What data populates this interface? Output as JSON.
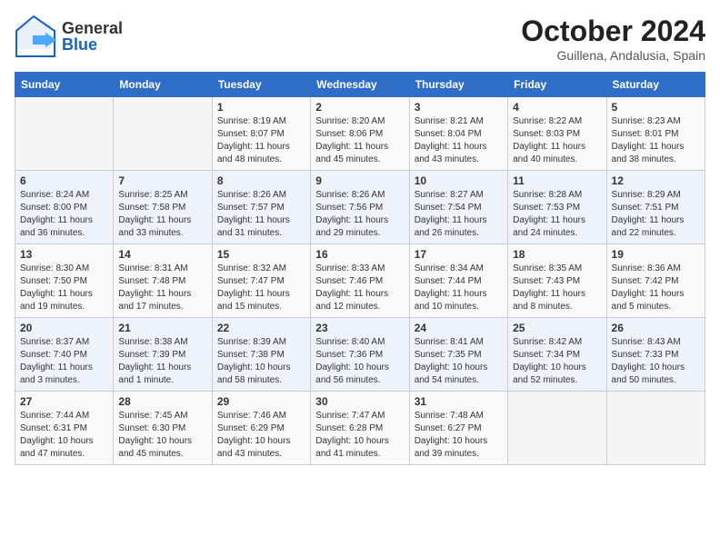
{
  "header": {
    "logo_general": "General",
    "logo_blue": "Blue",
    "month_title": "October 2024",
    "location": "Guillena, Andalusia, Spain"
  },
  "days_of_week": [
    "Sunday",
    "Monday",
    "Tuesday",
    "Wednesday",
    "Thursday",
    "Friday",
    "Saturday"
  ],
  "weeks": [
    [
      {
        "day": "",
        "sunrise": "",
        "sunset": "",
        "daylight": ""
      },
      {
        "day": "",
        "sunrise": "",
        "sunset": "",
        "daylight": ""
      },
      {
        "day": "1",
        "sunrise": "Sunrise: 8:19 AM",
        "sunset": "Sunset: 8:07 PM",
        "daylight": "Daylight: 11 hours and 48 minutes."
      },
      {
        "day": "2",
        "sunrise": "Sunrise: 8:20 AM",
        "sunset": "Sunset: 8:06 PM",
        "daylight": "Daylight: 11 hours and 45 minutes."
      },
      {
        "day": "3",
        "sunrise": "Sunrise: 8:21 AM",
        "sunset": "Sunset: 8:04 PM",
        "daylight": "Daylight: 11 hours and 43 minutes."
      },
      {
        "day": "4",
        "sunrise": "Sunrise: 8:22 AM",
        "sunset": "Sunset: 8:03 PM",
        "daylight": "Daylight: 11 hours and 40 minutes."
      },
      {
        "day": "5",
        "sunrise": "Sunrise: 8:23 AM",
        "sunset": "Sunset: 8:01 PM",
        "daylight": "Daylight: 11 hours and 38 minutes."
      }
    ],
    [
      {
        "day": "6",
        "sunrise": "Sunrise: 8:24 AM",
        "sunset": "Sunset: 8:00 PM",
        "daylight": "Daylight: 11 hours and 36 minutes."
      },
      {
        "day": "7",
        "sunrise": "Sunrise: 8:25 AM",
        "sunset": "Sunset: 7:58 PM",
        "daylight": "Daylight: 11 hours and 33 minutes."
      },
      {
        "day": "8",
        "sunrise": "Sunrise: 8:26 AM",
        "sunset": "Sunset: 7:57 PM",
        "daylight": "Daylight: 11 hours and 31 minutes."
      },
      {
        "day": "9",
        "sunrise": "Sunrise: 8:26 AM",
        "sunset": "Sunset: 7:56 PM",
        "daylight": "Daylight: 11 hours and 29 minutes."
      },
      {
        "day": "10",
        "sunrise": "Sunrise: 8:27 AM",
        "sunset": "Sunset: 7:54 PM",
        "daylight": "Daylight: 11 hours and 26 minutes."
      },
      {
        "day": "11",
        "sunrise": "Sunrise: 8:28 AM",
        "sunset": "Sunset: 7:53 PM",
        "daylight": "Daylight: 11 hours and 24 minutes."
      },
      {
        "day": "12",
        "sunrise": "Sunrise: 8:29 AM",
        "sunset": "Sunset: 7:51 PM",
        "daylight": "Daylight: 11 hours and 22 minutes."
      }
    ],
    [
      {
        "day": "13",
        "sunrise": "Sunrise: 8:30 AM",
        "sunset": "Sunset: 7:50 PM",
        "daylight": "Daylight: 11 hours and 19 minutes."
      },
      {
        "day": "14",
        "sunrise": "Sunrise: 8:31 AM",
        "sunset": "Sunset: 7:48 PM",
        "daylight": "Daylight: 11 hours and 17 minutes."
      },
      {
        "day": "15",
        "sunrise": "Sunrise: 8:32 AM",
        "sunset": "Sunset: 7:47 PM",
        "daylight": "Daylight: 11 hours and 15 minutes."
      },
      {
        "day": "16",
        "sunrise": "Sunrise: 8:33 AM",
        "sunset": "Sunset: 7:46 PM",
        "daylight": "Daylight: 11 hours and 12 minutes."
      },
      {
        "day": "17",
        "sunrise": "Sunrise: 8:34 AM",
        "sunset": "Sunset: 7:44 PM",
        "daylight": "Daylight: 11 hours and 10 minutes."
      },
      {
        "day": "18",
        "sunrise": "Sunrise: 8:35 AM",
        "sunset": "Sunset: 7:43 PM",
        "daylight": "Daylight: 11 hours and 8 minutes."
      },
      {
        "day": "19",
        "sunrise": "Sunrise: 8:36 AM",
        "sunset": "Sunset: 7:42 PM",
        "daylight": "Daylight: 11 hours and 5 minutes."
      }
    ],
    [
      {
        "day": "20",
        "sunrise": "Sunrise: 8:37 AM",
        "sunset": "Sunset: 7:40 PM",
        "daylight": "Daylight: 11 hours and 3 minutes."
      },
      {
        "day": "21",
        "sunrise": "Sunrise: 8:38 AM",
        "sunset": "Sunset: 7:39 PM",
        "daylight": "Daylight: 11 hours and 1 minute."
      },
      {
        "day": "22",
        "sunrise": "Sunrise: 8:39 AM",
        "sunset": "Sunset: 7:38 PM",
        "daylight": "Daylight: 10 hours and 58 minutes."
      },
      {
        "day": "23",
        "sunrise": "Sunrise: 8:40 AM",
        "sunset": "Sunset: 7:36 PM",
        "daylight": "Daylight: 10 hours and 56 minutes."
      },
      {
        "day": "24",
        "sunrise": "Sunrise: 8:41 AM",
        "sunset": "Sunset: 7:35 PM",
        "daylight": "Daylight: 10 hours and 54 minutes."
      },
      {
        "day": "25",
        "sunrise": "Sunrise: 8:42 AM",
        "sunset": "Sunset: 7:34 PM",
        "daylight": "Daylight: 10 hours and 52 minutes."
      },
      {
        "day": "26",
        "sunrise": "Sunrise: 8:43 AM",
        "sunset": "Sunset: 7:33 PM",
        "daylight": "Daylight: 10 hours and 50 minutes."
      }
    ],
    [
      {
        "day": "27",
        "sunrise": "Sunrise: 7:44 AM",
        "sunset": "Sunset: 6:31 PM",
        "daylight": "Daylight: 10 hours and 47 minutes."
      },
      {
        "day": "28",
        "sunrise": "Sunrise: 7:45 AM",
        "sunset": "Sunset: 6:30 PM",
        "daylight": "Daylight: 10 hours and 45 minutes."
      },
      {
        "day": "29",
        "sunrise": "Sunrise: 7:46 AM",
        "sunset": "Sunset: 6:29 PM",
        "daylight": "Daylight: 10 hours and 43 minutes."
      },
      {
        "day": "30",
        "sunrise": "Sunrise: 7:47 AM",
        "sunset": "Sunset: 6:28 PM",
        "daylight": "Daylight: 10 hours and 41 minutes."
      },
      {
        "day": "31",
        "sunrise": "Sunrise: 7:48 AM",
        "sunset": "Sunset: 6:27 PM",
        "daylight": "Daylight: 10 hours and 39 minutes."
      },
      {
        "day": "",
        "sunrise": "",
        "sunset": "",
        "daylight": ""
      },
      {
        "day": "",
        "sunrise": "",
        "sunset": "",
        "daylight": ""
      }
    ]
  ]
}
